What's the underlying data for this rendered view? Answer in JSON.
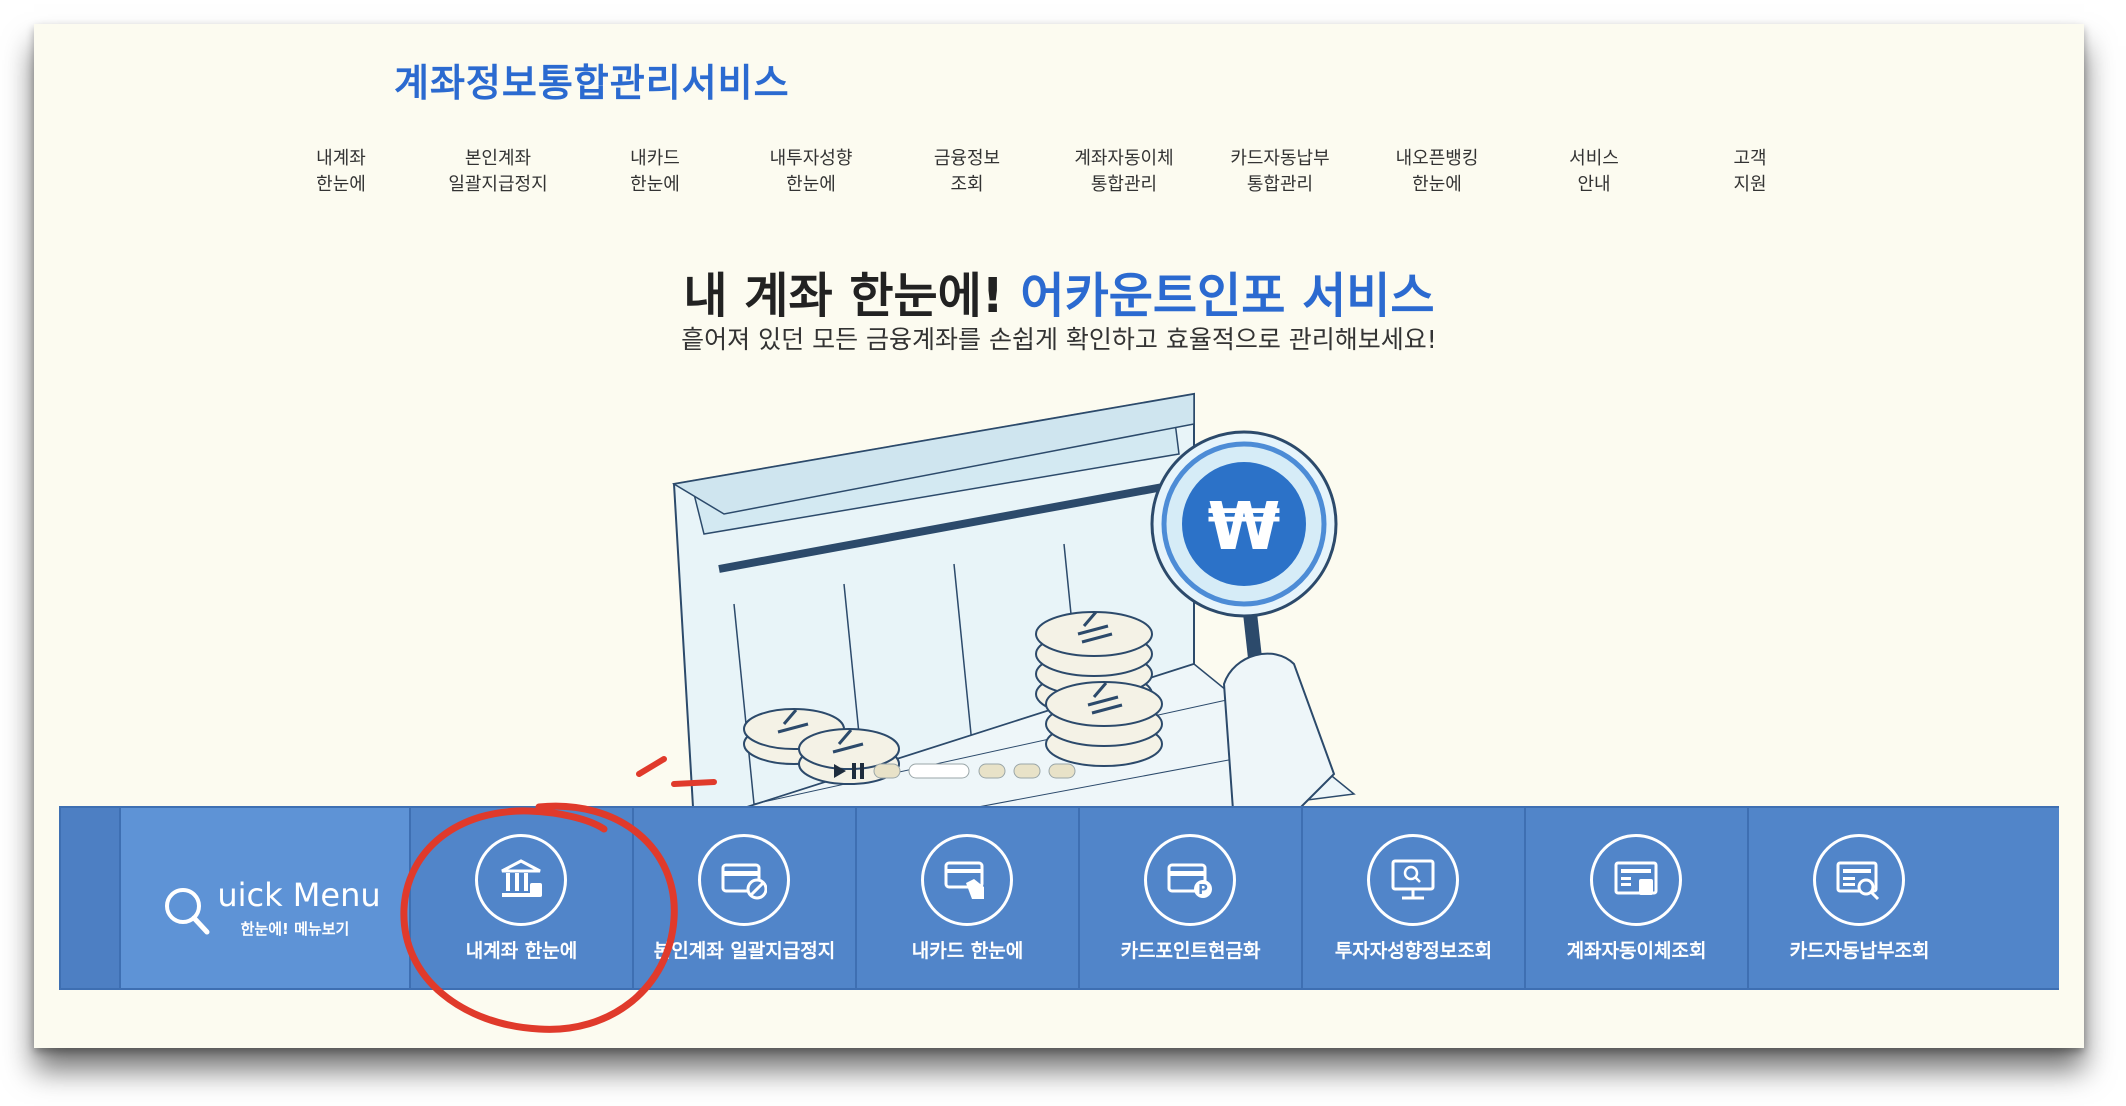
{
  "site": {
    "logo": "계좌정보통합관리서비스"
  },
  "nav": [
    {
      "line1": "내계좌",
      "line2": "한눈에"
    },
    {
      "line1": "본인계좌",
      "line2": "일괄지급정지"
    },
    {
      "line1": "내카드",
      "line2": "한눈에"
    },
    {
      "line1": "내투자성향",
      "line2": "한눈에"
    },
    {
      "line1": "금융정보",
      "line2": "조회"
    },
    {
      "line1": "계좌자동이체",
      "line2": "통합관리"
    },
    {
      "line1": "카드자동납부",
      "line2": "통합관리"
    },
    {
      "line1": "내오픈뱅킹",
      "line2": "한눈에"
    },
    {
      "line1": "서비스",
      "line2": "안내"
    },
    {
      "line1": "고객",
      "line2": "지원"
    }
  ],
  "hero": {
    "title_black": "내 계좌 한눈에!",
    "title_blue": "어카운트인포 서비스",
    "subtitle": "흩어져 있던 모든 금융계좌를 손쉽게 확인하고 효율적으로 관리해보세요!"
  },
  "quick_menu": {
    "title": "uick Menu",
    "subtitle": "한눈에! 메뉴보기",
    "items": [
      {
        "label": "내계좌 한눈에",
        "icon": "bank-icon"
      },
      {
        "label": "본인계좌 일괄지급정지",
        "icon": "card-block-icon"
      },
      {
        "label": "내카드 한눈에",
        "icon": "card-hand-icon"
      },
      {
        "label": "카드포인트현금화",
        "icon": "card-point-icon"
      },
      {
        "label": "투자자성향정보조회",
        "icon": "monitor-search-icon"
      },
      {
        "label": "계좌자동이체조회",
        "icon": "atm-icon"
      },
      {
        "label": "카드자동납부조회",
        "icon": "card-search-icon"
      }
    ]
  },
  "colors": {
    "brand_blue": "#2b6ad0",
    "quickbar": "#5185c9",
    "highlight_circle": "#e03a2b",
    "background": "#fcfbf0"
  }
}
